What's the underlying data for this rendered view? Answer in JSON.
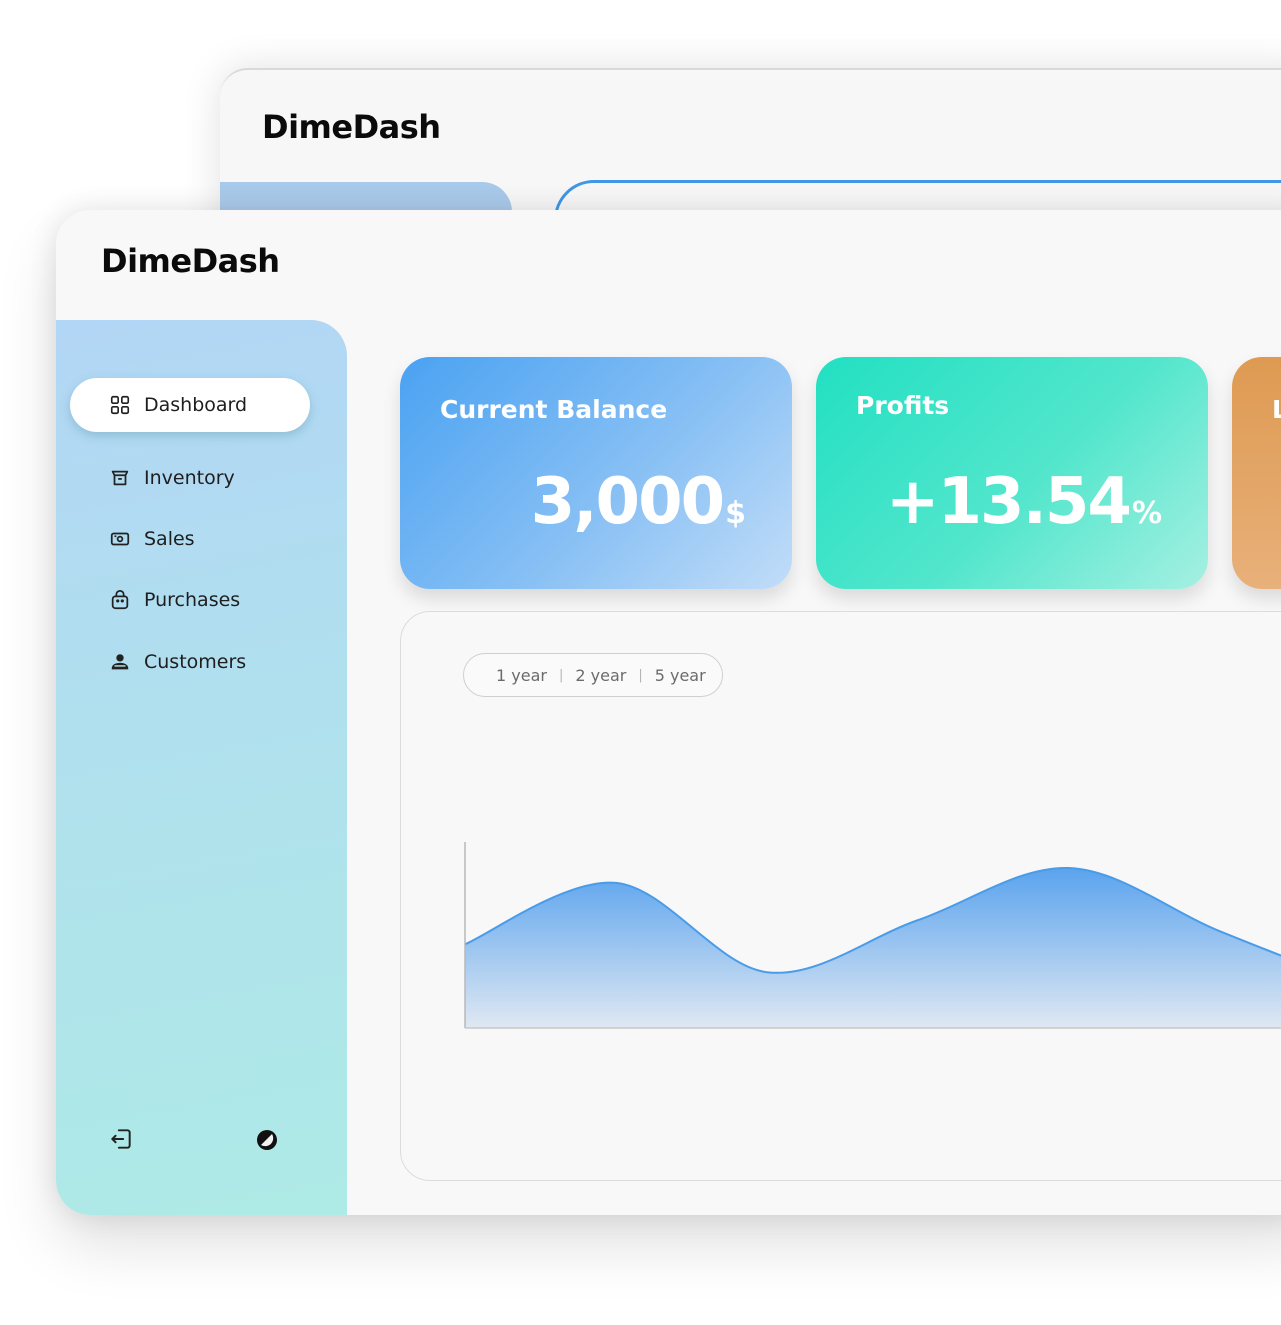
{
  "app": {
    "name": "DimeDash"
  },
  "sidebar": {
    "items": [
      {
        "label": "Dashboard",
        "icon": "grid-icon",
        "active": true
      },
      {
        "label": "Inventory",
        "icon": "box-icon",
        "active": false
      },
      {
        "label": "Sales",
        "icon": "cash-icon",
        "active": false
      },
      {
        "label": "Purchases",
        "icon": "shopping-bag-icon",
        "active": false
      },
      {
        "label": "Customers",
        "icon": "users-icon",
        "active": false
      }
    ],
    "bottom": [
      {
        "icon": "logout-icon"
      },
      {
        "icon": "theme-toggle-icon"
      }
    ]
  },
  "cards": {
    "balance": {
      "label": "Current Balance",
      "value": "3,000",
      "unit": "$"
    },
    "profits": {
      "label": "Profits",
      "value": "+13.54",
      "unit": "%"
    },
    "third": {
      "label": "L"
    }
  },
  "chart": {
    "range_options": [
      "1 year",
      "2 year",
      "5 year"
    ]
  },
  "colors": {
    "accent_blue": "#4aa2f2",
    "accent_teal": "#22e0c2",
    "accent_orange": "#de9a52",
    "chart_line": "#4a9be8"
  },
  "chart_data": {
    "type": "area",
    "x": [
      0,
      1,
      2,
      3,
      4,
      5,
      6
    ],
    "values": [
      0.45,
      0.78,
      0.3,
      0.58,
      0.86,
      0.52,
      0.2
    ],
    "title": "",
    "xlabel": "",
    "ylabel": "",
    "grid": false
  }
}
